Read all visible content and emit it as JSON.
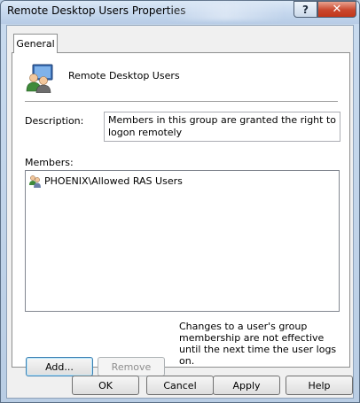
{
  "window": {
    "title": "Remote Desktop Users Properties",
    "help_glyph": "?",
    "close_glyph": "✕"
  },
  "tabs": [
    {
      "label": "General"
    }
  ],
  "group": {
    "name": "Remote Desktop Users",
    "icon": "group-icon"
  },
  "description": {
    "label": "Description:",
    "value": "Members in this group are granted the right to logon remotely"
  },
  "members": {
    "label": "Members:",
    "items": [
      {
        "name": "PHOENIX\\Allowed RAS Users",
        "icon": "user-group-icon"
      }
    ]
  },
  "buttons": {
    "add": "Add...",
    "remove": "Remove",
    "ok": "OK",
    "cancel": "Cancel",
    "apply": "Apply",
    "help": "Help"
  },
  "note": "Changes to a user's group membership are not effective until the next time the user logs on.",
  "colors": {
    "close_red": "#c9472d",
    "frame_blue": "#b9cde4",
    "focus_blue": "#3c7fb1"
  }
}
